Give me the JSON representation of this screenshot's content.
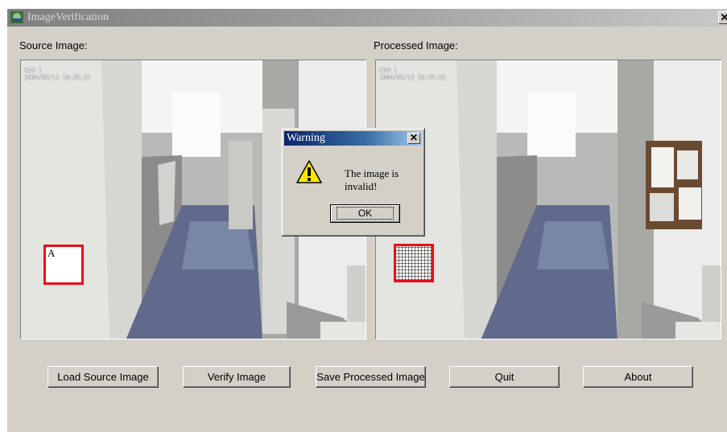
{
  "window": {
    "title": "ImageVerification",
    "close_glyph": "✕"
  },
  "source": {
    "label": "Source Image:",
    "stamp_line1": "CAM 1",
    "stamp_line2": "2004/03/12 10:35:22",
    "marker_letter": "A"
  },
  "processed": {
    "label": "Processed Image:",
    "stamp_line1": "CAM 1",
    "stamp_line2": "2004/03/12 10:35:22"
  },
  "buttons": {
    "load": "Load Source Image",
    "verify": "Verify Image",
    "save": "Save Processed Image",
    "quit": "Quit",
    "about": "About"
  },
  "dialog": {
    "title": "Warning",
    "close_glyph": "✕",
    "message": "The image is invalid!",
    "ok": "OK",
    "icon": "warning-icon"
  },
  "colors": {
    "marker_border": "#e8101a",
    "dialog_title_bar": "#0a246a"
  }
}
